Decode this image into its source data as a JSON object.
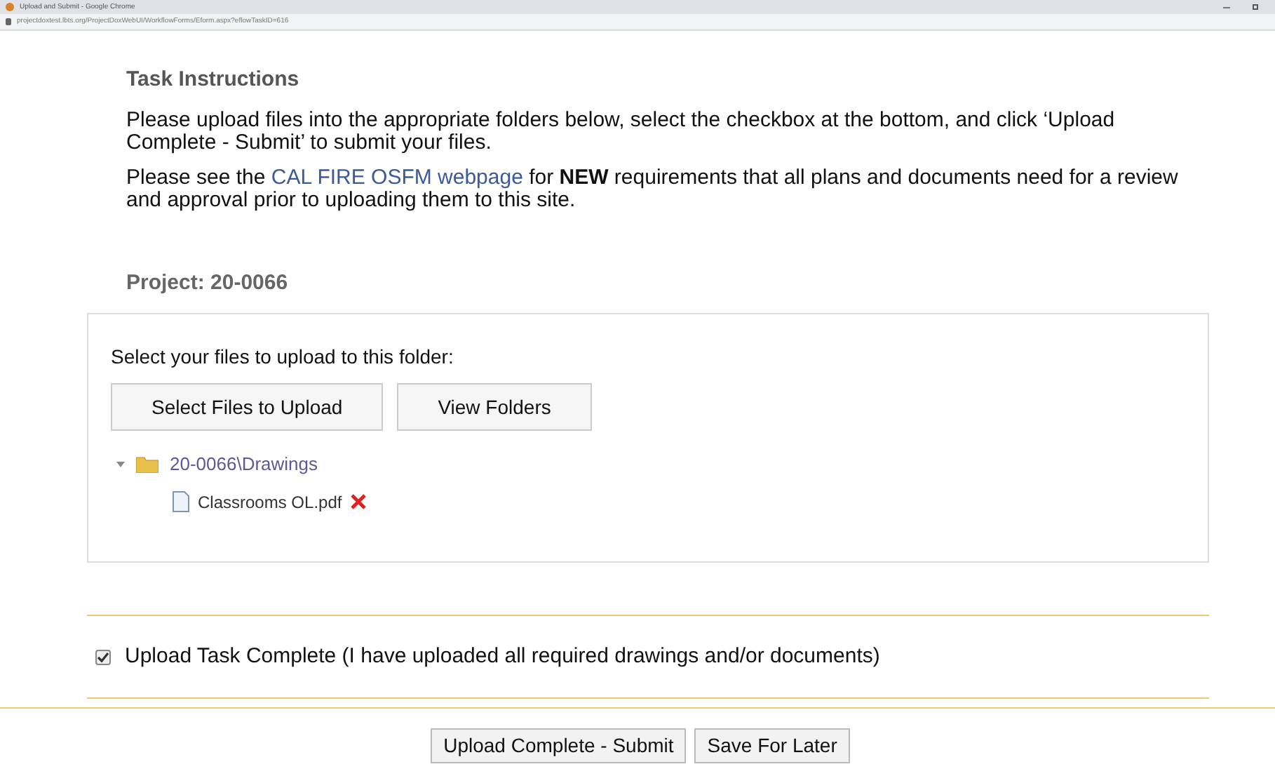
{
  "window": {
    "title": "Upload and Submit - Google Chrome",
    "url": "projectdoxtest.lbts.org/ProjectDoxWebUI/WorkflowForms/Eform.aspx?eflowTaskID=616"
  },
  "instructions": {
    "heading": "Task Instructions",
    "paragraphs": [
      {
        "before": "Please upload files into the appropriate folders below, select the checkbox at the bottom, and click ‘Upload Complete - Submit’ to submit your files."
      },
      {
        "before": "Please see the ",
        "link": "CAL FIRE OSFM webpage",
        "after": " for **NEW** requirements that all plans and documents need for a review and approval prior to uploading them to this site."
      }
    ]
  },
  "project": "Project: 20-0066",
  "upload": {
    "prompt": "Select your files to upload to this folder:",
    "buttons": [
      "Select Files to Upload",
      "View Folders"
    ],
    "tree": [
      {
        "label": "20-0066\\Drawings",
        "expanded": true,
        "children": [
          {
            "label": "Classrooms OL.pdf"
          }
        ]
      }
    ]
  },
  "confirm": {
    "label": "Upload Task Complete (I have uploaded all required drawings and/or documents)",
    "checked": true
  },
  "actions": [
    "Upload Complete - Submit",
    "Save For Later"
  ]
}
